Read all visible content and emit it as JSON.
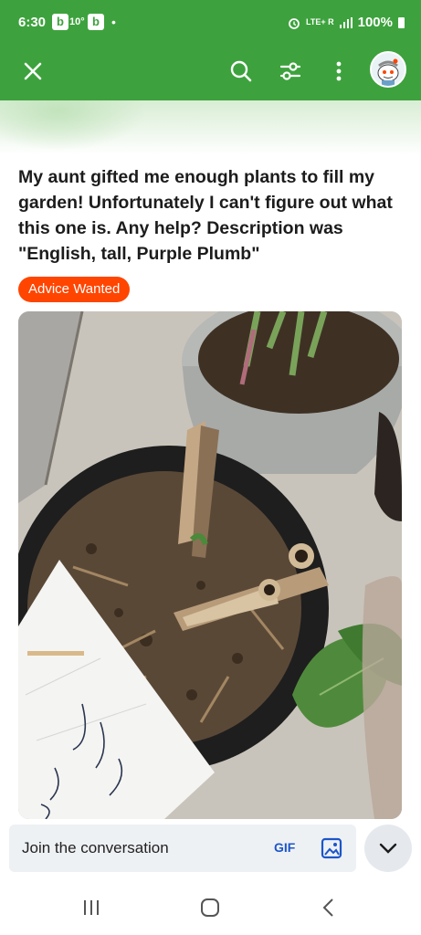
{
  "status_bar": {
    "time": "6:30",
    "badge_1": "b",
    "temperature": "10°",
    "badge_2": "b",
    "dot": "•",
    "network_top": "LTE+ R",
    "battery_percent": "100%"
  },
  "app_bar": {
    "close_icon": "close-icon",
    "search_icon": "search-icon",
    "filter_icon": "sliders-icon",
    "more_icon": "more-vertical-icon",
    "avatar": "snoo-avatar",
    "color": "#3da23d"
  },
  "post": {
    "title": "My aunt gifted me enough plants to fill my garden! Unfortunately I can't figure out what this one is. Any help? Description was \"English, tall, Purple Plumb\"",
    "flair": "Advice Wanted",
    "flair_color": "#ff4500",
    "image_alt": "Dry plant stalks in a black pot next to a handwritten note"
  },
  "reply": {
    "placeholder": "Join the conversation",
    "gif_label": "GIF",
    "image_icon": "image-icon",
    "expand_icon": "chevron-down-icon"
  },
  "nav": {
    "recents_icon": "recents-icon",
    "home_icon": "home-icon",
    "back_icon": "back-icon"
  }
}
